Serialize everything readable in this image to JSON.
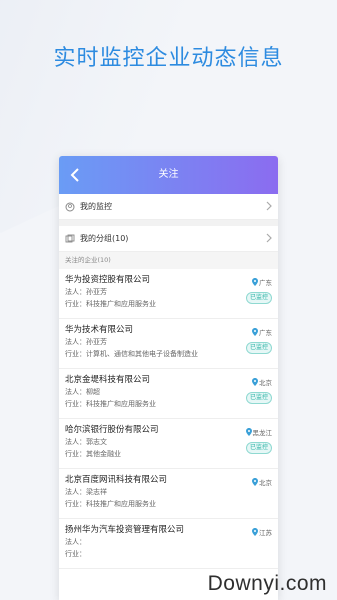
{
  "promo": {
    "title": "实时监控企业动态信息"
  },
  "header": {
    "title": "关注"
  },
  "nav": {
    "monitor_label": "我的监控",
    "group_label": "我的分组(10)"
  },
  "section": {
    "label": "关注的企业(10)"
  },
  "labels": {
    "legal": "法人：",
    "industry": "行业："
  },
  "companies": [
    {
      "name": "华为投资控股有限公司",
      "legal": "孙亚芳",
      "industry": "科技推广和应用服务业",
      "location": "广东",
      "badge": "已监控"
    },
    {
      "name": "华为技术有限公司",
      "legal": "孙亚芳",
      "industry": "计算机、通信和其他电子设备制造业",
      "location": "广东",
      "badge": "已监控"
    },
    {
      "name": "北京金堤科技有限公司",
      "legal": "柳超",
      "industry": "科技推广和应用服务业",
      "location": "北京",
      "badge": "已监控"
    },
    {
      "name": "哈尔滨银行股份有限公司",
      "legal": "郭志文",
      "industry": "其他金融业",
      "location": "黑龙江",
      "badge": "已监控"
    },
    {
      "name": "北京百度网讯科技有限公司",
      "legal": "梁志祥",
      "industry": "科技推广和应用服务业",
      "location": "北京",
      "badge": ""
    },
    {
      "name": "扬州华为汽车投资管理有限公司",
      "legal": "",
      "industry": "",
      "location": "江苏",
      "badge": ""
    }
  ],
  "watermark": "Downyi.com",
  "colors": {
    "accent": "#2d8be0",
    "header_start": "#6a9cf5",
    "header_end": "#8b6cf0",
    "badge": "#2bb3a5"
  }
}
